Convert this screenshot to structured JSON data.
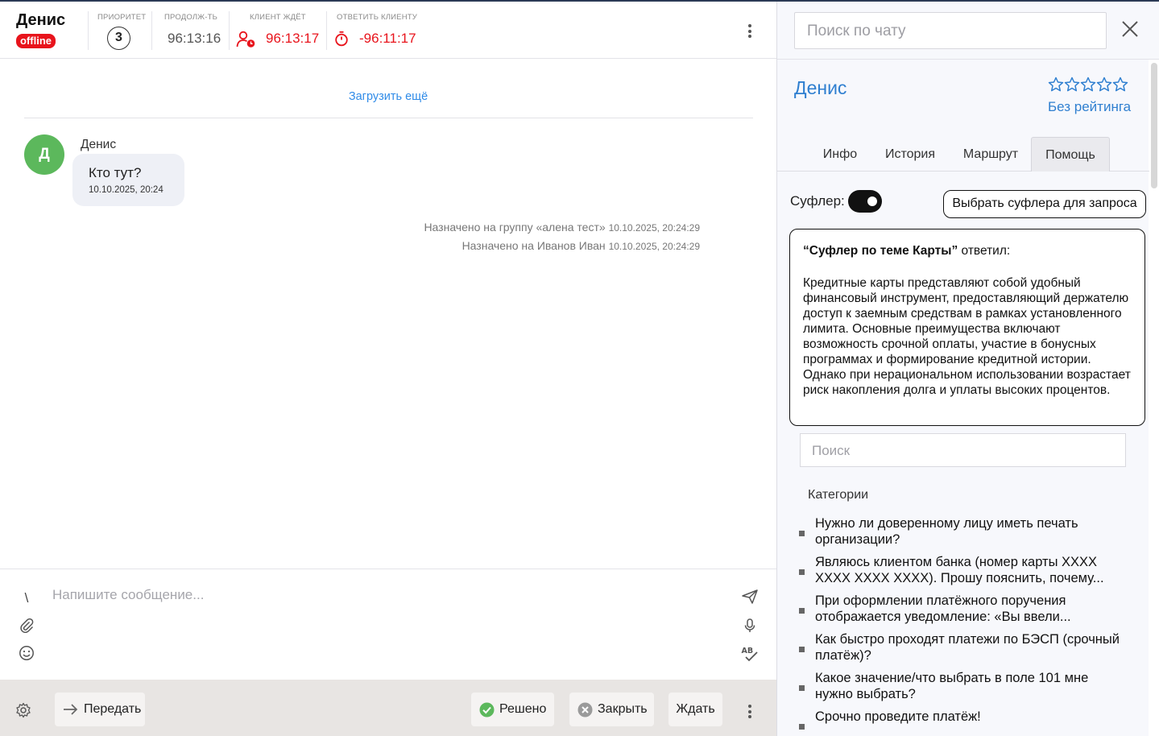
{
  "header": {
    "client_name": "Денис",
    "status": "offline",
    "metrics": {
      "priority": {
        "label": "ПРИОРИТЕТ",
        "value": "3"
      },
      "duration": {
        "label": "ПРОДОЛЖ-ТЬ",
        "value": "96:13:16"
      },
      "client_waits": {
        "label": "КЛИЕНТ ЖДЁТ",
        "value": "96:13:17"
      },
      "reply_client": {
        "label": "ОТВЕТИТЬ КЛИЕНТУ",
        "value": "-96:11:17"
      }
    }
  },
  "chat": {
    "load_more": "Загрузить ещё",
    "messages": [
      {
        "avatar_letter": "Д",
        "sender": "Денис",
        "text": "Кто тут?",
        "time": "10.10.2025, 20:24"
      }
    ],
    "system_events": [
      {
        "text": "Назначено на группу «алена тест»",
        "time": "10.10.2025, 20:24:29"
      },
      {
        "text": "Назначено на Иванов Иван",
        "time": "10.10.2025, 20:24:29"
      }
    ]
  },
  "composer": {
    "placeholder": "Напишите сообщение...",
    "slash_symbol": "\\"
  },
  "footer": {
    "transfer": "Передать",
    "resolved": "Решено",
    "close": "Закрыть",
    "wait": "Ждать"
  },
  "right_panel": {
    "search_placeholder": "Поиск по чату",
    "client_name": "Денис",
    "rating_text": "Без рейтинга",
    "rating_stars": 0,
    "rating_max": 5,
    "tabs": [
      {
        "label": "Инфо",
        "active": false
      },
      {
        "label": "История",
        "active": false
      },
      {
        "label": "Маршрут",
        "active": false
      },
      {
        "label": "Помощь",
        "active": true
      }
    ],
    "sufler_label": "Суфлер:",
    "sufler_enabled": true,
    "choose_sufler_button": "Выбрать суфлера для запроса",
    "answer": {
      "source": "“Суфлер по теме Карты”",
      "verb": " ответил:",
      "text": "Кредитные карты представляют собой удобный финансовый инструмент, предоставляющий держателю доступ к заемным средствам в рамках установленного лимита. Основные преимущества включают возможность срочной оплаты, участие в бонусных программах и формирование кредитной истории. Однако при нерациональном использовании возрастает риск накопления долга и уплаты высоких процентов."
    },
    "help_search_placeholder": "Поиск",
    "categories_title": "Категории",
    "categories": [
      "Нужно ли доверенному лицу иметь печать организации?",
      "Являюсь клиентом банка (номер карты XXXX XXXX XXXX XXXX). Прошу пояснить, почему...",
      "При оформлении платёжного поручения отображается уведомление: «Вы ввели...",
      "Как быстро проходят платежи по БЭСП (срочный платёж)?",
      "Какое значение/что выбрать в поле 101 мне нужно выбрать?",
      "Срочно проведите платёж!"
    ]
  },
  "colors": {
    "accent_blue": "#2f7fd0",
    "link_blue": "#2f8be8",
    "danger_red": "#e8141c",
    "avatar_green": "#5cb85c",
    "footer_bg": "#e8e5e3"
  }
}
